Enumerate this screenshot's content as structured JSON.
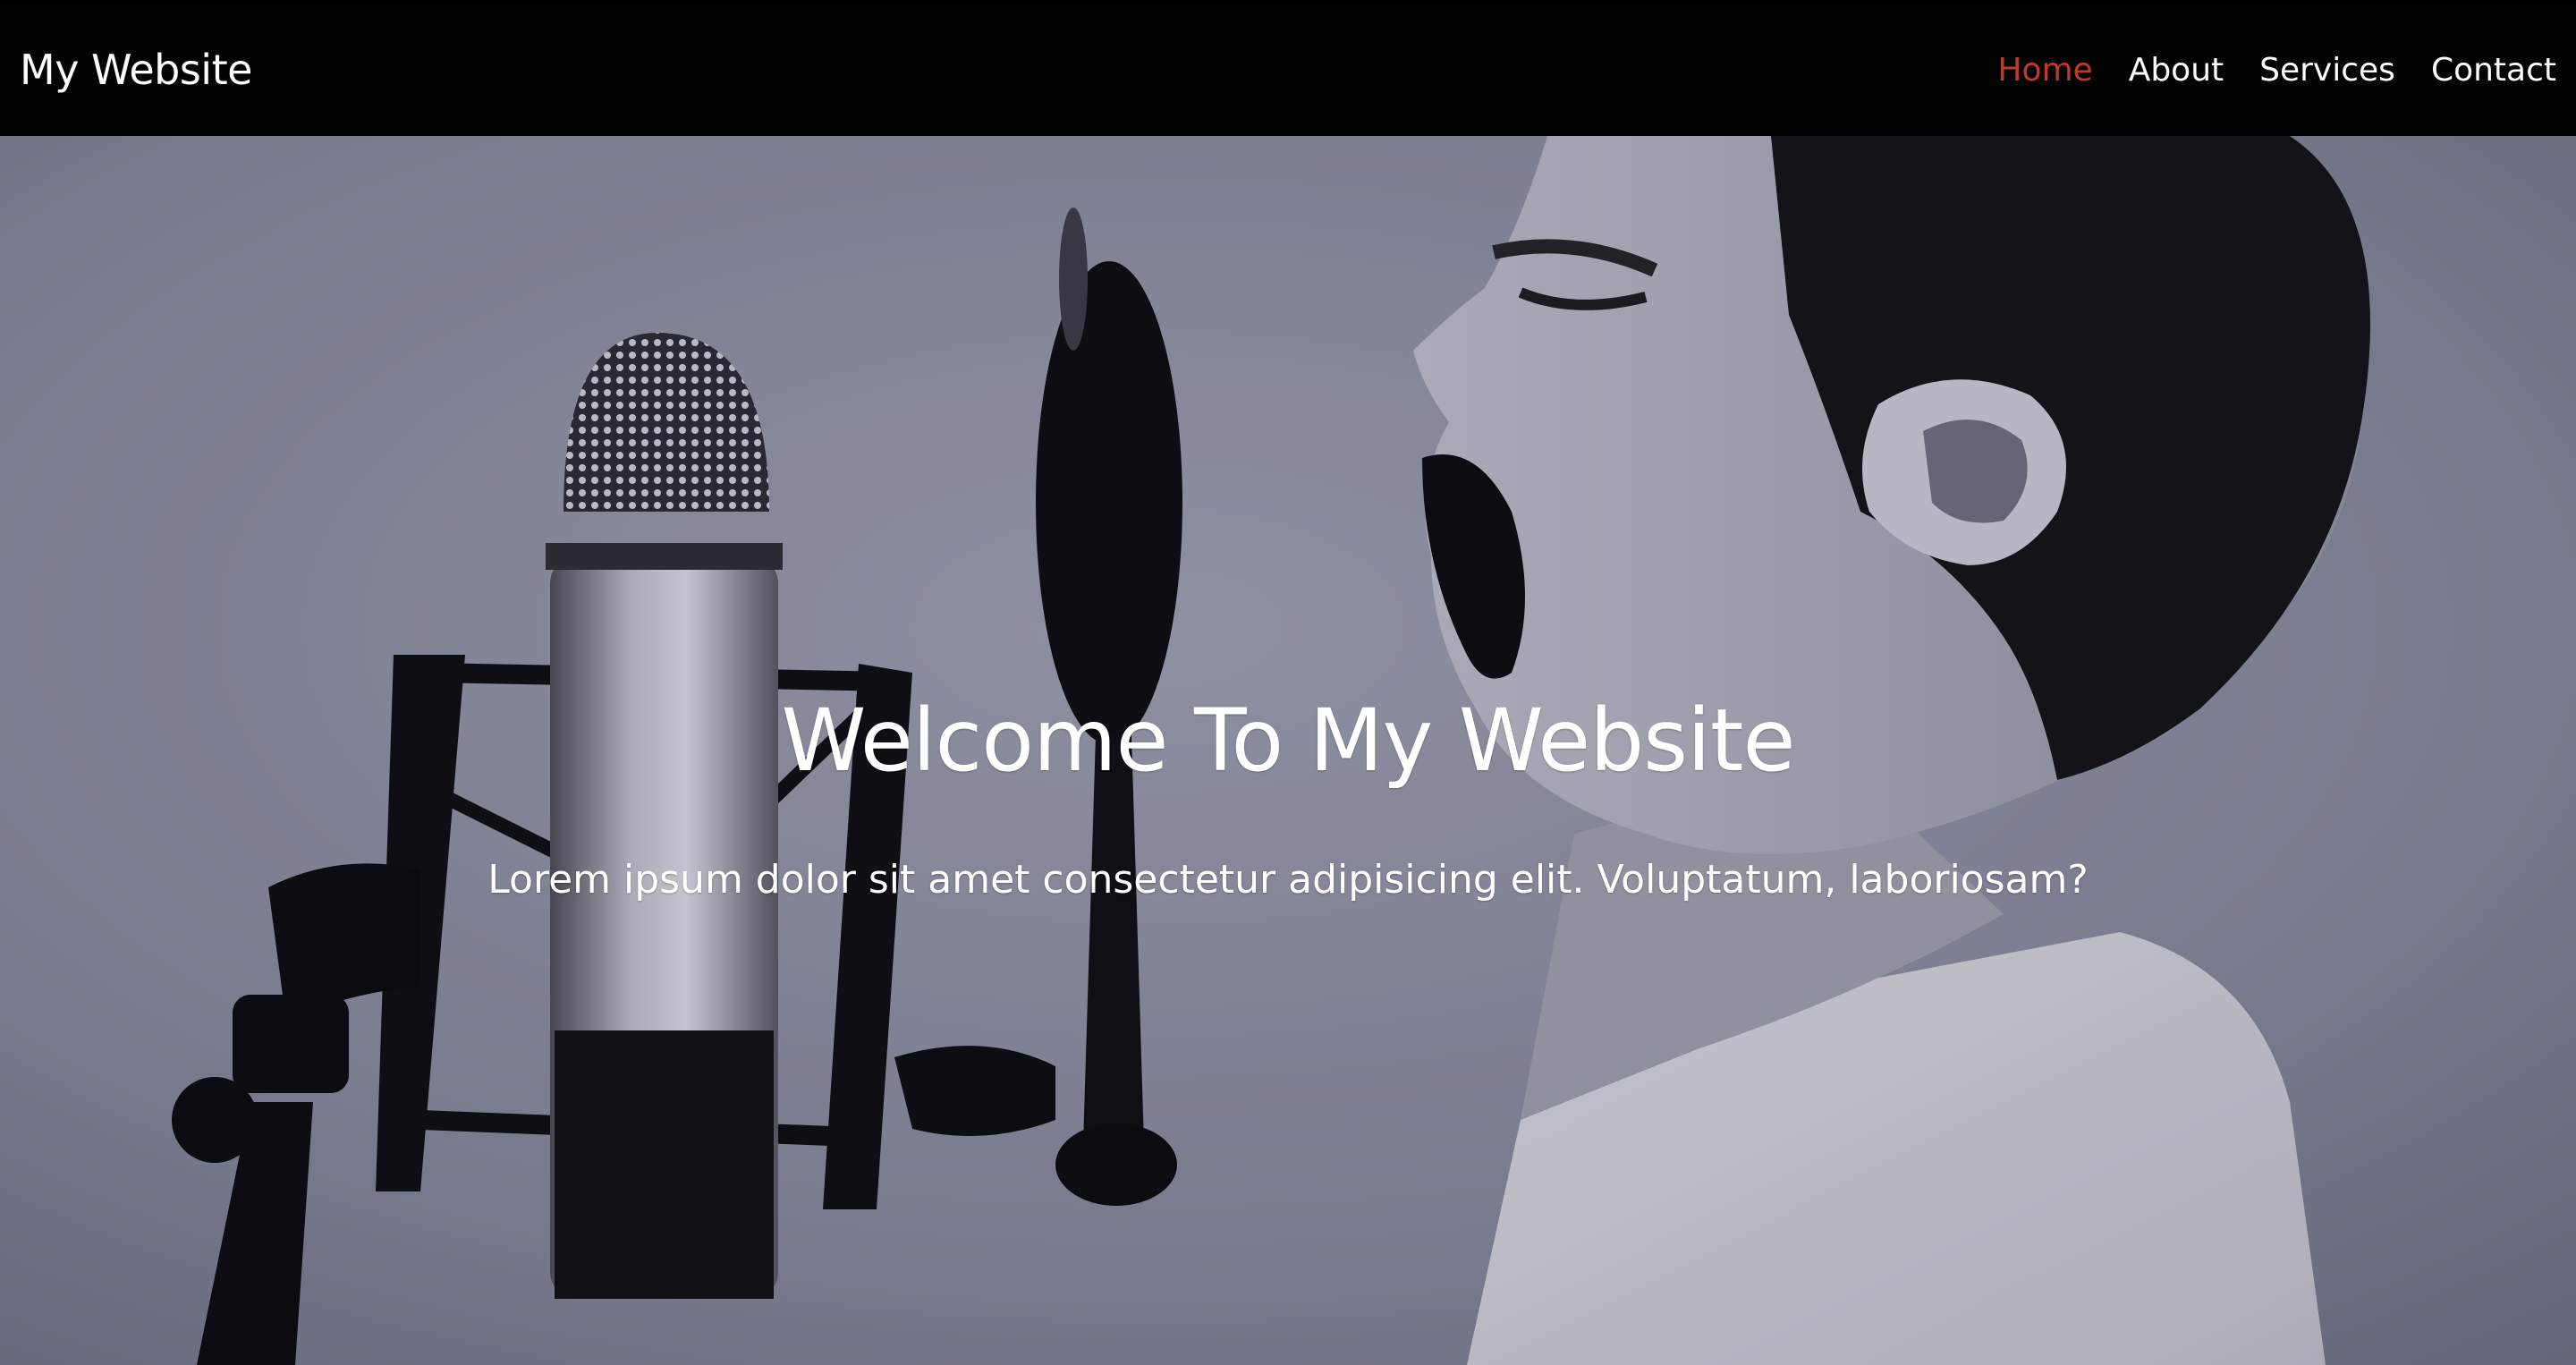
{
  "navbar": {
    "logo": "My Website",
    "links": [
      {
        "label": "Home",
        "active": true
      },
      {
        "label": "About",
        "active": false
      },
      {
        "label": "Services",
        "active": false
      },
      {
        "label": "Contact",
        "active": false
      }
    ]
  },
  "hero": {
    "title": "Welcome To My Website",
    "subtitle": "Lorem ipsum dolor sit amet consectetur adipisicing elit. Voluptatum, laboriosam?"
  },
  "colors": {
    "navbar_background": "#030303",
    "active_link": "#c0392b",
    "text": "#ffffff"
  }
}
